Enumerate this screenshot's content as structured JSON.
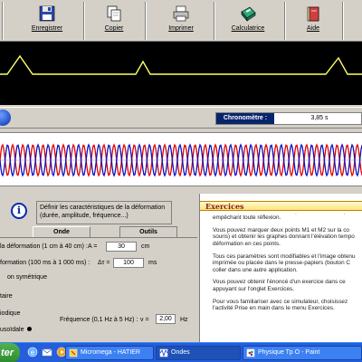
{
  "toolbar": {
    "buttons": [
      {
        "label": "Enregistrer",
        "icon": "save-icon"
      },
      {
        "label": "Copier",
        "icon": "copy-icon"
      },
      {
        "label": "Imprimer",
        "icon": "printer-icon"
      },
      {
        "label": "Calculatrice",
        "icon": "calculator-icon"
      },
      {
        "label": "Aide",
        "icon": "help-icon"
      }
    ]
  },
  "chronometer": {
    "label": "Chronomètre :",
    "value": "3,85 s"
  },
  "info": {
    "text": "Définir les caractéristiques de la déformation (durée, amplitude, fréquence...)"
  },
  "tabs": [
    "Onde",
    "Outils"
  ],
  "form": {
    "amplitude": {
      "label": "la déformation (1 cm à 40 cm) :",
      "symbol": "A =",
      "value": "30",
      "unit": "cm"
    },
    "duration": {
      "label": "formation (100 ms à 1 000 ms) :",
      "symbol": "Δτ =",
      "value": "100",
      "unit": "ms"
    },
    "symmetric_option": "on symétrique",
    "option_1": "taire",
    "option_2": "iodique",
    "option_3": "usoïdale",
    "frequency": {
      "label": "Fréquence (0,1 Hz à 5 Hz) :",
      "symbol": "ν =",
      "value": "2,00",
      "unit": "Hz"
    }
  },
  "exercises": {
    "title": "Exercices",
    "intro": "La source est représentée par la règle rouge à gauche, extrémité peut être fixe, libre ou placée dans un dispo empêchant toute réflexion.",
    "p1": "Vous pouvez marquer deux points M1 et M2 sur la co souris) et obtenir les graphes donnant l'élévation tempo déformation en ces points.",
    "p2": "Tous ces paramètres sont modifiables et l'image obtenu imprimée ou placée dans le presse-papiers (bouton C coller dans une autre application.",
    "p3": "Vous pouvez obtenir l'énoncé d'un exercice dans ce appuyant sur l'onglet Exercices.",
    "p4": "Pour vous familiariser avec ce simulateur, choisissez l'activité Prise en main dans le menu Exercices."
  },
  "taskbar": {
    "start": "ter",
    "tasks": [
      "Micromega - HATIER",
      "Ondes",
      "Physique Tp O - Paint"
    ]
  },
  "colors": {
    "wave_red": "#e00000",
    "wave_blue": "#1010c0",
    "pulse_yellow": "#ffff66",
    "chrono_title_bg": "#08246b",
    "taskbar": "#245edb",
    "exercise_title": "#8b1a1a"
  }
}
